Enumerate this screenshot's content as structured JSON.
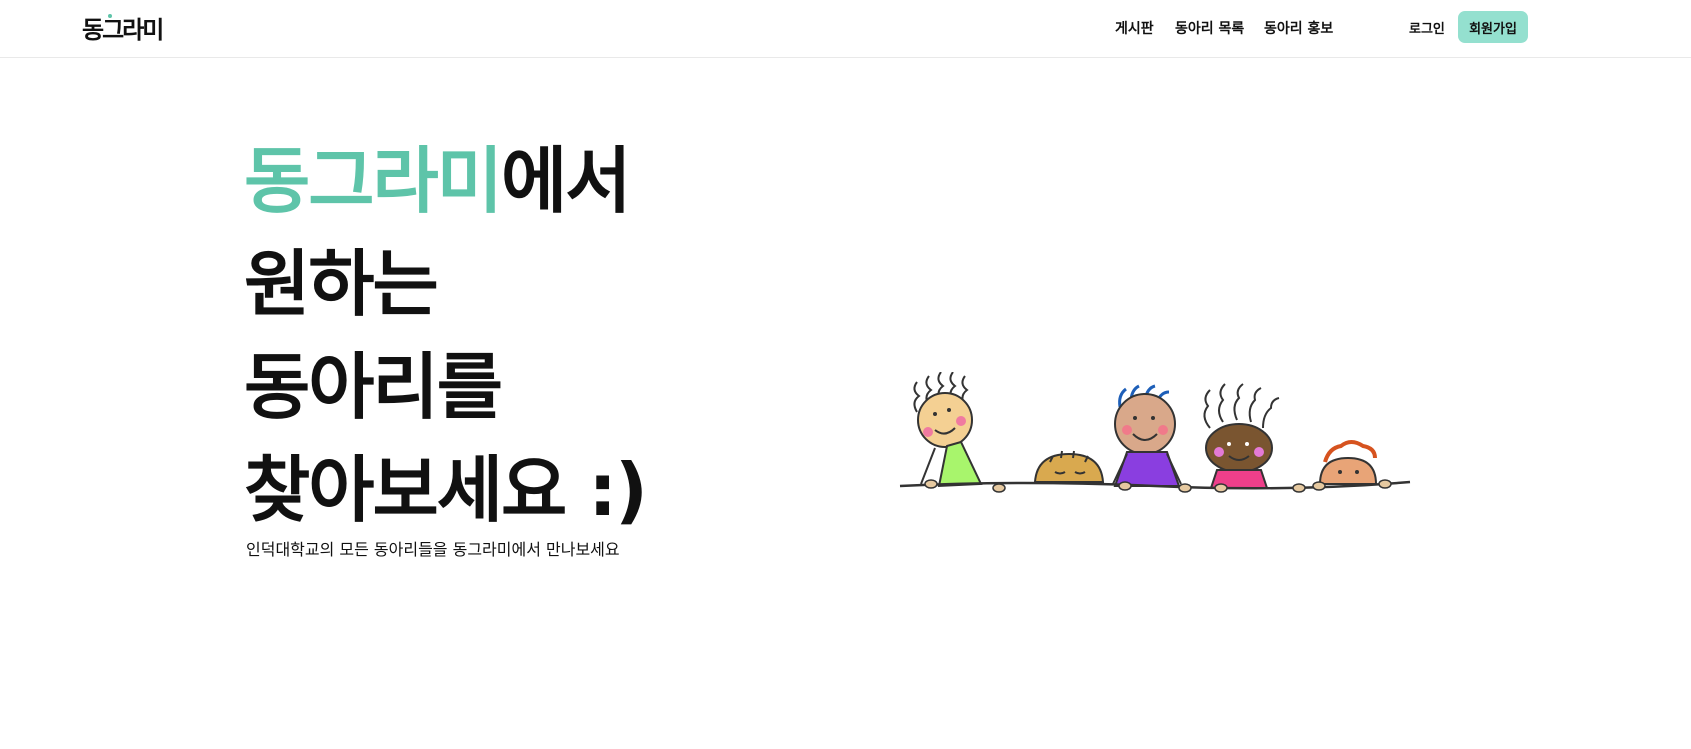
{
  "header": {
    "logo": "동그라미",
    "nav": [
      {
        "label": "게시판"
      },
      {
        "label": "동아리 목록"
      },
      {
        "label": "동아리 홍보"
      }
    ],
    "login_label": "로그인",
    "signup_label": "회원가입"
  },
  "hero": {
    "title_accent": "동그라미",
    "title_rest": "에서",
    "line2": "원하는",
    "line3": "동아리를",
    "line4": "찾아보세요 :)",
    "subtitle": "인덕대학교의 모든 동아리들을 동그라미에서 만나보세요"
  },
  "illustration": {
    "icon": "kids-peeking-illustration",
    "colors": {
      "accent": "#5ec4a9",
      "signup_bg": "#94e0cf",
      "kid1_shirt": "#a8f56c",
      "kid3_shirt": "#8a3ee0",
      "kid4_shirt": "#ee3f8a",
      "kid4_hair": "#7ef07e",
      "kid1_hair": "#f6f04a"
    }
  }
}
